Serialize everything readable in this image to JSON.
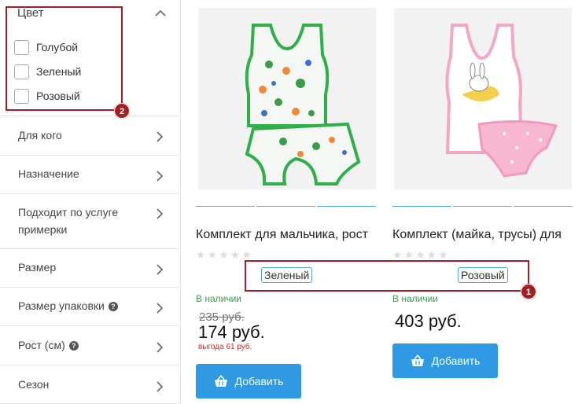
{
  "sidebar": {
    "color_filter": {
      "title": "Цвет",
      "options": [
        {
          "label": "Голубой",
          "checked": false
        },
        {
          "label": "Зеленый",
          "checked": false
        },
        {
          "label": "Розовый",
          "checked": false
        }
      ]
    },
    "filters": [
      {
        "label": "Для кого"
      },
      {
        "label": "Назначение"
      },
      {
        "label": "Подходит по услуге примерки"
      },
      {
        "label": "Размер"
      },
      {
        "label": "Размер упаковки",
        "help": "?"
      },
      {
        "label": "Рост (см)",
        "help": "?"
      },
      {
        "label": "Сезон"
      }
    ]
  },
  "annotations": {
    "badge_1": "1",
    "badge_2": "2",
    "color": "#a31f24"
  },
  "products": [
    {
      "title": "Комплект для мальчика, рост",
      "rating_stars": "★★★★★",
      "color_tag": "Зеленый",
      "stock": "В наличии",
      "old_price": "235 руб.",
      "price": "174 руб.",
      "saving": "выгода 61 руб.",
      "add_label": "Добавить"
    },
    {
      "title": "Комплект (майка, трусы) для",
      "rating_stars": "★★★★★",
      "color_tag": "Розовый",
      "stock": "В наличии",
      "price": "403 руб.",
      "add_label": "Добавить"
    }
  ],
  "colors": {
    "accent": "#2f9ae3",
    "stock_green": "#33a04a",
    "saving_red": "#dd2222",
    "tag_border": "#4aa3c9"
  }
}
